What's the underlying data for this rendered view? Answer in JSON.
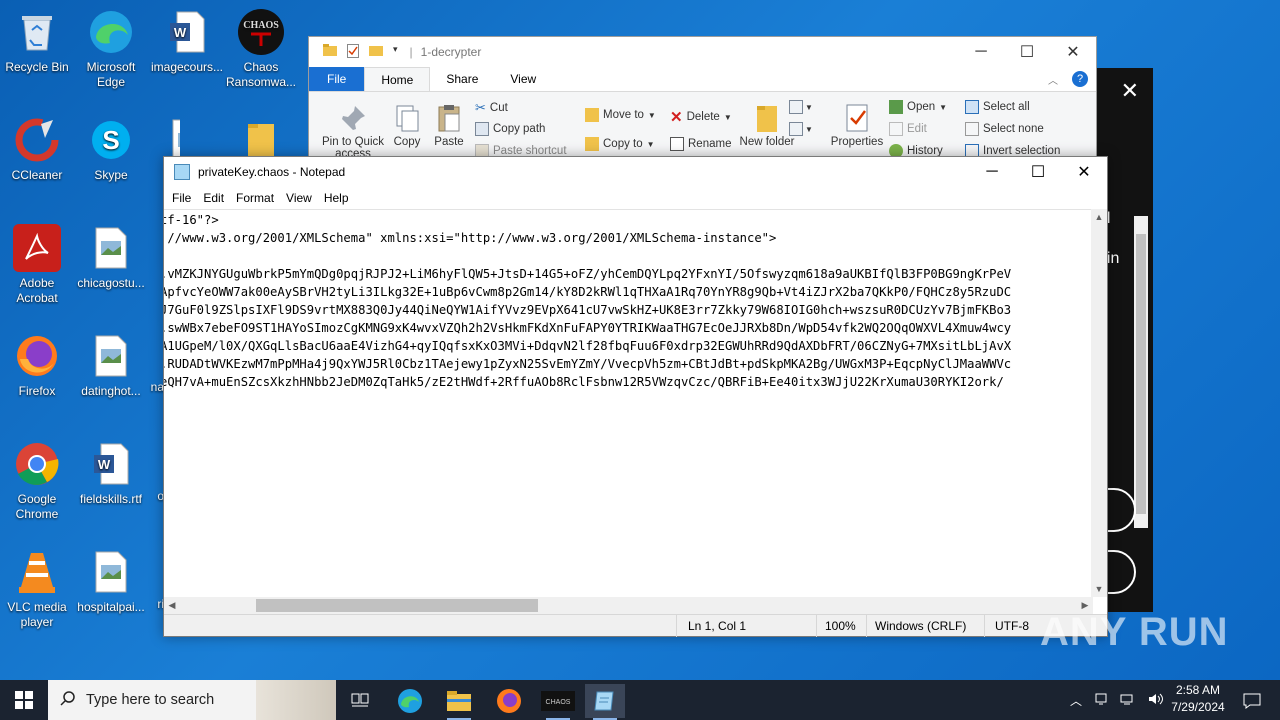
{
  "desktop": {
    "icons": [
      {
        "label": "Recycle Bin"
      },
      {
        "label": "Microsoft Edge"
      },
      {
        "label": "imagecours..."
      },
      {
        "label": "Chaos Ransomwa..."
      },
      {
        "label": "CCleaner"
      },
      {
        "label": "Skype"
      },
      {
        "label": "in"
      },
      {
        "label": "Adobe Acrobat"
      },
      {
        "label": "chicagostu..."
      },
      {
        "label": "Firefox"
      },
      {
        "label": "datinghot..."
      },
      {
        "label": "na"
      },
      {
        "label": "Google Chrome"
      },
      {
        "label": "fieldskills.rtf"
      },
      {
        "label": "o"
      },
      {
        "label": "VLC media player"
      },
      {
        "label": "hospitalpai..."
      },
      {
        "label": "ri"
      }
    ]
  },
  "background_window": {
    "partial_texts": [
      "t",
      "al",
      "oin"
    ]
  },
  "explorer": {
    "title": "1-decrypter",
    "tabs": {
      "file": "File",
      "home": "Home",
      "share": "Share",
      "view": "View"
    },
    "ribbon": {
      "pin": "Pin to Quick access",
      "copy": "Copy",
      "paste": "Paste",
      "cut": "Cut",
      "copy_path": "Copy path",
      "paste_shortcut": "Paste shortcut",
      "move_to": "Move to",
      "copy_to": "Copy to",
      "delete": "Delete",
      "rename": "Rename",
      "new_folder": "New folder",
      "properties": "Properties",
      "open": "Open",
      "edit": "Edit",
      "history": "History",
      "select_all": "Select all",
      "select_none": "Select none",
      "invert_selection": "Invert selection"
    }
  },
  "notepad": {
    "title": "privateKey.chaos - Notepad",
    "menu": {
      "file": "File",
      "edit": "Edit",
      "format": "Format",
      "view": "View",
      "help": "Help"
    },
    "content": "tf-16\"?>\n //www.w3.org/2001/XMLSchema\" xmlns:xsi=\"http://www.w3.org/2001/XMLSchema-instance\">\n\n.vMZKJNYGUguWbrkP5mYmQDg0pqjRJPJ2+LiM6hyFlQW5+JtsD+14G5+oFZ/yhCemDQYLpq2YFxnYI/5Ofswyzqm618a9aUKBIfQlB3FP0BG9ngKrPeV\nApfvcYeOWW7ak00eAySBrVH2tyLi3ILkg32E+1uBp6vCwm8p2Gm14/kY8D2kRWl1qTHXaA1Rq70YnYR8g9Qb+Vt4iZJrX2ba7QKkP0/FQHCz8y5RzuDC\nJ7GuF0l9ZSlpsIXFl9DS9vrtMX883Q0Jy44QiNeQYW1AifYVvz9EVpX641cU7vwSkHZ+UK8E3rr7Zkky79W68IOIG0hch+wszsuR0DCUzYv7BjmFKBo3\n.swWBx7ebeFO9ST1HAYoSImozCgKMNG9xK4wvxVZQh2h2VsHkmFKdXnFuFAPY0YTRIKWaaTHG7EcOeJJRXb8Dn/WpD54vfk2WQ2OQqOWXVL4Xmuw4wcy\nA1UGpeM/l0X/QXGqLlsBacU6aaE4VizhG4+qyIQqfsxKxO3MVi+DdqvN2lf28fbqFuu6F0xdrp32EGWUhRRd9QdAXDbFRT/06CZNyG+7MXsitLbLjAvX\n.RUDADtWVKEzwM7mPpMHa4j9QxYWJ5Rl0Cbz1TAejewy1pZyxN25SvEmYZmY/VvecpVh5zm+CBtJdBt+pdSkpMKA2Bg/UWGxM3P+EqcpNyClJMaaWWVc\neQH7vA+muEnSZcsXkzhHNbb2JeDM0ZqTaHk5/zE2tHWdf+2RffuAOb8RclFsbnw12R5VWzqvCzc/QBRFiB+Ee40itx3WJjU22KrXumaU30RYKI2ork/",
    "status": {
      "position": "Ln 1, Col 1",
      "zoom": "100%",
      "line_ending": "Windows (CRLF)",
      "encoding": "UTF-8"
    }
  },
  "taskbar": {
    "search_placeholder": "Type here to search",
    "time": "2:58 AM",
    "date": "7/29/2024"
  },
  "watermark": "ANY RUN"
}
